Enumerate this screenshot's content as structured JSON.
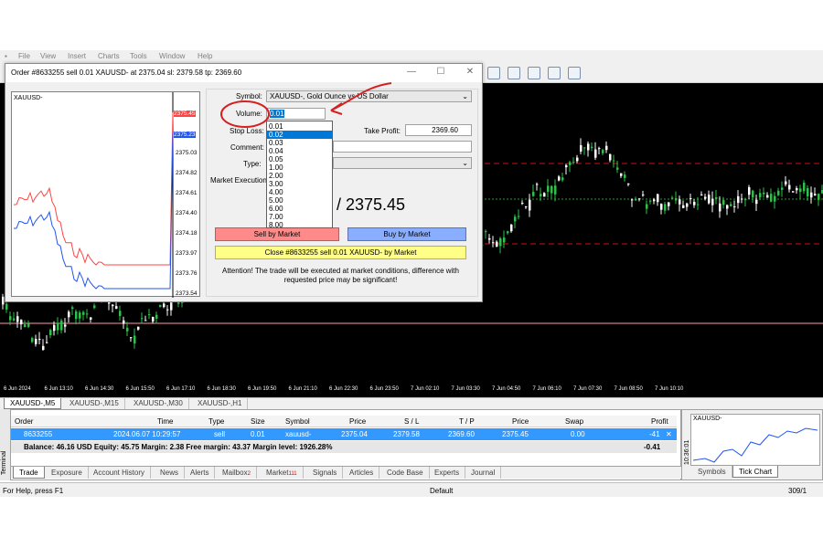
{
  "menu": [
    "File",
    "View",
    "Insert",
    "Charts",
    "Tools",
    "Window",
    "Help"
  ],
  "chart": {
    "time_labels": [
      "6 Jun 2024",
      "6 Jun 13:10",
      "6 Jun 14:30",
      "6 Jun 15:50",
      "6 Jun 17:10",
      "6 Jun 18:30",
      "6 Jun 19:50",
      "6 Jun 21:10",
      "6 Jun 22:30",
      "6 Jun 23:50",
      "7 Jun 02:10",
      "7 Jun 03:30",
      "7 Jun 04:50",
      "7 Jun 06:10",
      "7 Jun 07:30",
      "7 Jun 08:50",
      "7 Jun 10:10"
    ]
  },
  "symbol_tabs": [
    "XAUUSD-,M5",
    "XAUUSD-,M15",
    "XAUUSD-,M30",
    "XAUUSD-,H1"
  ],
  "dialog": {
    "title": "Order #8633255 sell 0.01 XAUUSD- at 2375.04 sl: 2379.58 tp: 2369.60",
    "mini_chart": {
      "symbol": "XAUUSD-",
      "price_labels": [
        "2375.45",
        "2375.23",
        "2375.03",
        "2374.82",
        "2374.61",
        "2374.40",
        "2374.18",
        "2373.97",
        "2373.76",
        "2373.54"
      ],
      "colors": {
        "bid": "#ff4444",
        "ask": "#2255ee"
      }
    },
    "form": {
      "symbol_label": "Symbol:",
      "symbol_value": "XAUUSD-, Gold Ounce vs US Dollar",
      "volume_label": "Volume:",
      "volume_value": "0.01",
      "stop_loss_label": "Stop Loss:",
      "take_profit_label": "Take Profit:",
      "take_profit_value": "2369.60",
      "comment_label": "Comment:",
      "type_label": "Type:",
      "execution_label": "Market Execution",
      "price_display": "/ 2375.45",
      "sell_button": "Sell by Market",
      "buy_button": "Buy by Market",
      "close_button": "Close #8633255 sell 0.01 XAUUSD- by Market",
      "attention": "Attention! The trade will be executed at market conditions, difference with requested price may be significant!"
    },
    "volume_options": [
      "0.01",
      "0.02",
      "0.03",
      "0.04",
      "0.05",
      "1.00",
      "2.00",
      "3.00",
      "4.00",
      "5.00",
      "6.00",
      "7.00",
      "8.00"
    ],
    "volume_highlight_index": 1
  },
  "terminal": {
    "side_label": "Terminal",
    "headers": {
      "order": "Order",
      "time": "Time",
      "type": "Type",
      "size": "Size",
      "symbol": "Symbol",
      "price": "Price",
      "sl": "S / L",
      "tp": "T / P",
      "cur_price": "Price",
      "swap": "Swap",
      "profit": "Profit"
    },
    "row": {
      "order": "8633255",
      "time": "2024.06.07 10:29:57",
      "type": "sell",
      "size": "0.01",
      "symbol": "xauusd-",
      "price": "2375.04",
      "sl": "2379.58",
      "tp": "2369.60",
      "cur_price": "2375.45",
      "swap": "0.00",
      "profit": "-41"
    },
    "balance_text": "Balance: 46.16 USD  Equity: 45.75  Margin: 2.38  Free margin: 43.37  Margin level: 1926.28%",
    "balance_profit": "-0.41",
    "tabs": [
      "Trade",
      "Exposure",
      "Account History",
      "News",
      "Alerts",
      "Mailbox",
      "Market",
      "Signals",
      "Articles",
      "Code Base",
      "Experts",
      "Journal"
    ],
    "mailbox_badge": "2",
    "market_badge": "111"
  },
  "mini_panel": {
    "symbol": "XAUUSD-",
    "time": "10:36:01",
    "tabs": [
      "Symbols",
      "Tick Chart"
    ]
  },
  "status": {
    "help": "For Help, press F1",
    "profile": "Default",
    "traffic": "309/1"
  },
  "annotation_color": "#d42020"
}
